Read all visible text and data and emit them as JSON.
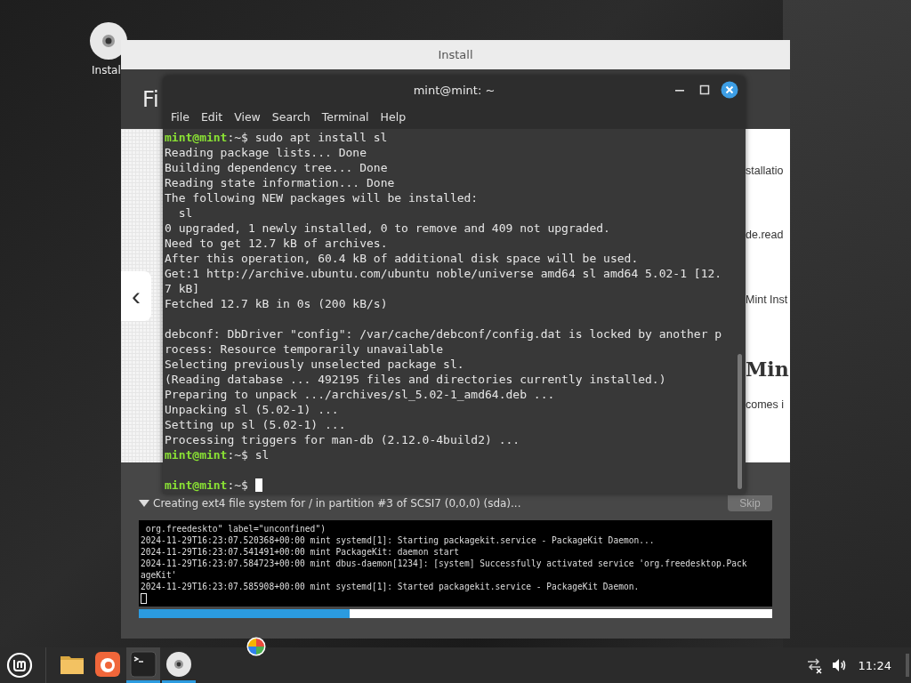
{
  "desktop_icons": [
    {
      "label": "Instal"
    }
  ],
  "installer": {
    "title": "Install",
    "heading": "Fi",
    "prev_button": "‹",
    "slide_texts": [
      {
        "kind": "text",
        "text": "stallatio"
      },
      {
        "kind": "text",
        "text": "de.read"
      },
      {
        "kind": "text",
        "text": "Mint Inst"
      },
      {
        "kind": "heading",
        "text": "Min"
      },
      {
        "kind": "text",
        "text": "comes i"
      }
    ],
    "step": {
      "text": "Creating ext4 file system for / in partition #3 of SCSI7 (0,0,0) (sda)...",
      "expanded": true
    },
    "skip_button": {
      "label": "Skip",
      "disabled": true
    },
    "log": [
      " org.freedeskto\" label=\"unconfined\")",
      "2024-11-29T16:23:07.520368+00:00 mint systemd[1]: Starting packagekit.service - PackageKit Daemon...",
      "2024-11-29T16:23:07.541491+00:00 mint PackageKit: daemon start",
      "2024-11-29T16:23:07.584723+00:00 mint dbus-daemon[1234]: [system] Successfully activated service 'org.freedesktop.Pack",
      "ageKit'",
      "2024-11-29T16:23:07.585908+00:00 mint systemd[1]: Started packagekit.service - PackageKit Daemon."
    ],
    "log_cursor": true,
    "progress": {
      "level": 0.333
    }
  },
  "terminal": {
    "title": "mint@mint: ~",
    "menu": [
      "File",
      "Edit",
      "View",
      "Search",
      "Terminal",
      "Help"
    ],
    "lines": [
      {
        "kind": "prompt",
        "user": "mint@mint",
        "path": ":~$",
        "command": "sudo apt install sl"
      },
      {
        "kind": "output",
        "text": "Reading package lists... Done"
      },
      {
        "kind": "output",
        "text": "Building dependency tree... Done"
      },
      {
        "kind": "output",
        "text": "Reading state information... Done"
      },
      {
        "kind": "output",
        "text": "The following NEW packages will be installed:"
      },
      {
        "kind": "output",
        "text": "  sl"
      },
      {
        "kind": "output",
        "text": "0 upgraded, 1 newly installed, 0 to remove and 409 not upgraded."
      },
      {
        "kind": "output",
        "text": "Need to get 12.7 kB of archives."
      },
      {
        "kind": "output",
        "text": "After this operation, 60.4 kB of additional disk space will be used."
      },
      {
        "kind": "output",
        "text": "Get:1 http://archive.ubuntu.com/ubuntu noble/universe amd64 sl amd64 5.02-1 [12."
      },
      {
        "kind": "output",
        "text": "7 kB]"
      },
      {
        "kind": "output",
        "text": "Fetched 12.7 kB in 0s (200 kB/s)"
      },
      {
        "kind": "blank"
      },
      {
        "kind": "output",
        "text": "debconf: DbDriver \"config\": /var/cache/debconf/config.dat is locked by another p"
      },
      {
        "kind": "output",
        "text": "rocess: Resource temporarily unavailable"
      },
      {
        "kind": "output",
        "text": "Selecting previously unselected package sl."
      },
      {
        "kind": "output",
        "text": "(Reading database ... 492195 files and directories currently installed.)"
      },
      {
        "kind": "output",
        "text": "Preparing to unpack .../archives/sl_5.02-1_amd64.deb ..."
      },
      {
        "kind": "output",
        "text": "Unpacking sl (5.02-1) ..."
      },
      {
        "kind": "output",
        "text": "Setting up sl (5.02-1) ..."
      },
      {
        "kind": "output",
        "text": "Processing triggers for man-db (2.12.0-4build2) ..."
      },
      {
        "kind": "prompt",
        "user": "mint@mint",
        "path": ":~$",
        "command": "sl"
      },
      {
        "kind": "blank"
      },
      {
        "kind": "prompt",
        "user": "mint@mint",
        "path": ":~$",
        "cursor": true
      }
    ]
  },
  "taskbar": {
    "apps": [
      {
        "kind": "folder",
        "selected": false,
        "running": false
      },
      {
        "kind": "browser",
        "selected": false,
        "running": false
      },
      {
        "kind": "terminal",
        "selected": true,
        "running": true
      },
      {
        "kind": "disc",
        "selected": false,
        "running": true
      }
    ],
    "clock": "11:24"
  }
}
